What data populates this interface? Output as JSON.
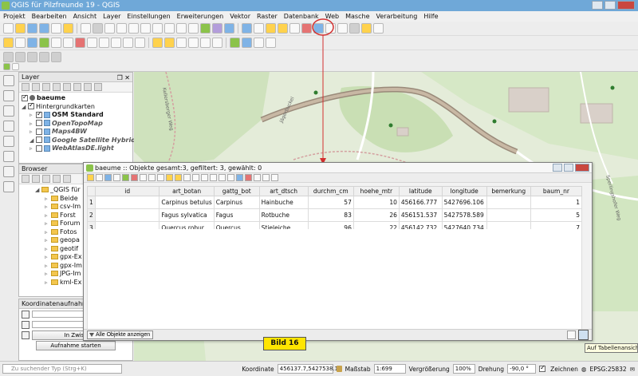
{
  "app": {
    "title": "QGIS für Pilzfreunde 19 - QGIS"
  },
  "menu": [
    "Projekt",
    "Bearbeiten",
    "Ansicht",
    "Layer",
    "Einstellungen",
    "Erweiterungen",
    "Vektor",
    "Raster",
    "Datenbank",
    "Web",
    "Masche",
    "Verarbeitung",
    "Hilfe"
  ],
  "layers_panel": {
    "title": "Layer",
    "items": [
      {
        "label": "baeume",
        "checked": true,
        "type": "point",
        "bold": true,
        "indent": 0
      },
      {
        "label": "Hintergrundkarten",
        "checked": true,
        "type": "group",
        "bold": false,
        "indent": 0
      },
      {
        "label": "OSM Standard",
        "checked": true,
        "type": "tile",
        "bold": true,
        "indent": 1
      },
      {
        "label": "OpenTopoMap",
        "checked": false,
        "type": "tile",
        "italic": true,
        "indent": 1
      },
      {
        "label": "Maps4BW",
        "checked": false,
        "type": "tile",
        "italic": true,
        "indent": 1
      },
      {
        "label": "Google Satellite Hybrid",
        "checked": false,
        "type": "tile",
        "italic": true,
        "indent": 1
      },
      {
        "label": "WebAtlasDE.light",
        "checked": false,
        "type": "tile",
        "italic": true,
        "indent": 1
      }
    ]
  },
  "browser_panel": {
    "title": "Browser",
    "root": "_QGIS für",
    "items": [
      "Beide",
      "csv-Im",
      "Forst",
      "Forum",
      "Fotos",
      "geopa",
      "geotif",
      "gpx-Ex",
      "gpx-Im",
      "JPG-Im",
      "kml-Ex"
    ]
  },
  "coord_panel": {
    "title": "Koordinatenaufnahme",
    "clipboard_button": "In Zwischen",
    "start_button": "Aufnahme starten"
  },
  "attribute_table": {
    "title": "baeume :: Objekte gesamt:3, gefiltert: 3, gewählt: 0",
    "columns": [
      "id",
      "art_botan",
      "gattg_bot",
      "art_dtsch",
      "durchm_cm",
      "hoehe_mtr",
      "latitude",
      "longitude",
      "bemerkung",
      "baum_nr"
    ],
    "rows": [
      {
        "n": "1",
        "cells": [
          "",
          "Carpinus betulus",
          "Carpinus",
          "Hainbuche",
          "57",
          "10",
          "456166.777",
          "5427696.106",
          "",
          "1"
        ]
      },
      {
        "n": "2",
        "cells": [
          "",
          "Fagus sylvatica",
          "Fagus",
          "Rotbuche",
          "83",
          "26",
          "456151.537",
          "5427578.589",
          "",
          "5"
        ]
      },
      {
        "n": "3",
        "cells": [
          "",
          "Quercus robur",
          "Quercus",
          "Stieleiche",
          "96",
          "22",
          "456142.732",
          "5427640.734",
          "",
          "7"
        ]
      }
    ],
    "show_all_button": "Alle Objekte anzeigen",
    "tooltip": "Auf Tabellenansicht u"
  },
  "annotation": {
    "label": "Bild 16"
  },
  "map": {
    "labels": [
      "Kellersberger Weg",
      "Jägerbuckel",
      "Sperlingshofer Weg"
    ]
  },
  "statusbar": {
    "search_placeholder": "Zu suchender Typ (Strg+K)",
    "coordinate_label": "Koordinate",
    "coordinate_value": "456137.7,5427538.1",
    "scale_label": "Maßstab",
    "scale_value": "1:699",
    "magnifier_label": "Vergrößerung",
    "magnifier_value": "100%",
    "rotation_label": "Drehung",
    "rotation_value": "-90,0 °",
    "render_label": "Zeichnen",
    "crs_value": "EPSG:25832"
  },
  "colors": {
    "accent": "#6fa8d8",
    "highlight": "#ffe500",
    "red_marker": "#d32f2f"
  }
}
